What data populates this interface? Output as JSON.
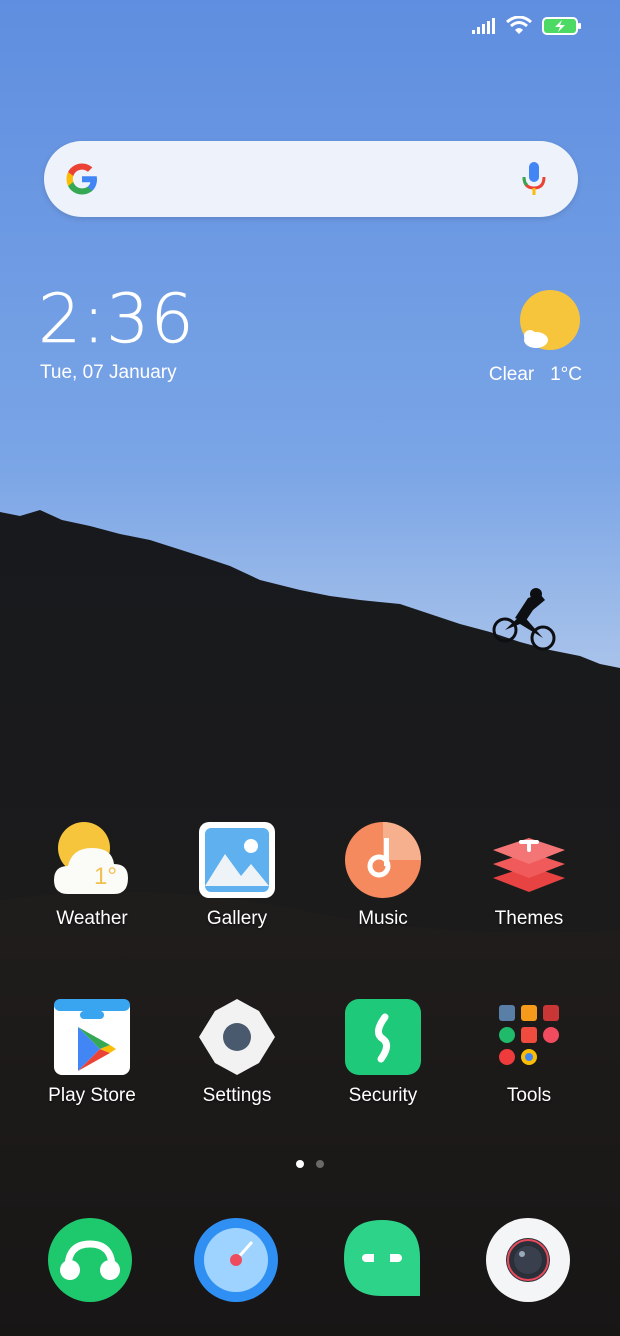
{
  "status_bar": {
    "signal_icon": "signal-icon",
    "wifi_icon": "wifi-icon",
    "battery_icon": "battery-charging-icon"
  },
  "search": {
    "placeholder": "",
    "logo_icon": "google-g-icon",
    "mic_icon": "microphone-icon"
  },
  "clock": {
    "time": "2:36",
    "date": "Tue, 07 January"
  },
  "weather_widget": {
    "condition": "Clear",
    "temperature": "1°C",
    "icon": "sun-cloud-icon"
  },
  "apps_row1": [
    {
      "label": "Weather",
      "icon": "weather-app-icon"
    },
    {
      "label": "Gallery",
      "icon": "gallery-app-icon"
    },
    {
      "label": "Music",
      "icon": "music-app-icon"
    },
    {
      "label": "Themes",
      "icon": "themes-app-icon"
    }
  ],
  "apps_row2": [
    {
      "label": "Play Store",
      "icon": "play-store-icon"
    },
    {
      "label": "Settings",
      "icon": "settings-gear-icon"
    },
    {
      "label": "Security",
      "icon": "security-app-icon"
    },
    {
      "label": "Tools",
      "icon": "tools-folder-icon"
    }
  ],
  "weather_app_badge": "1°",
  "page_indicator": {
    "pages": 2,
    "active": 0
  },
  "dock": [
    {
      "icon": "phone-icon"
    },
    {
      "icon": "browser-icon"
    },
    {
      "icon": "messages-icon"
    },
    {
      "icon": "camera-icon"
    }
  ],
  "colors": {
    "sky_top": "#6f9fe6",
    "sky_bottom": "#bfd3ef",
    "ground": "#111315"
  }
}
